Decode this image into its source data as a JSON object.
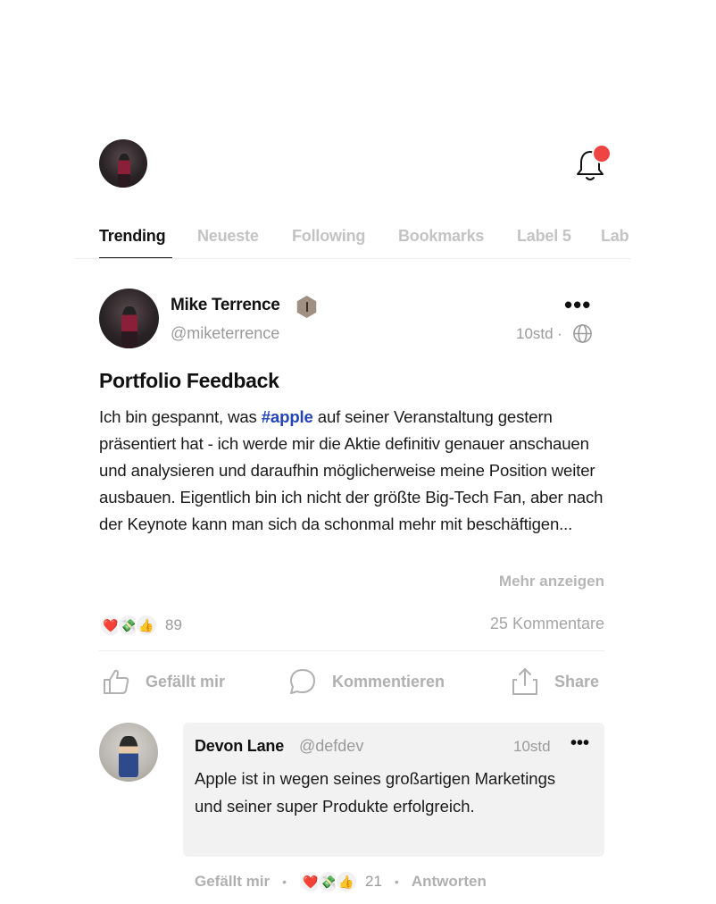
{
  "header": {
    "profile_avatar": "user-avatar",
    "notification_icon": "bell-icon",
    "notification_dot_color": "#ef4444"
  },
  "tabs": [
    {
      "label": "Trending",
      "active": true
    },
    {
      "label": "Neueste",
      "active": false
    },
    {
      "label": "Following",
      "active": false
    },
    {
      "label": "Bookmarks",
      "active": false
    },
    {
      "label": "Label 5",
      "active": false
    },
    {
      "label": "Lab",
      "active": false
    }
  ],
  "post": {
    "author": "Mike Terrence",
    "handle": "@miketerrence",
    "more_icon": "•••",
    "time": "10std ·",
    "visibility_icon": "globe-icon",
    "title": "Portfolio Feedback",
    "body_before": "Ich bin gespannt, was ",
    "hashtag": "#apple",
    "body_after": " auf seiner Veranstaltung gestern präsentiert hat - ich werde mir die Aktie definitiv genauer anschauen und analysieren und daraufhin möglicherweise meine Position weiter ausbauen. Eigentlich bin ich nicht der größte Big-Tech Fan, aber nach der Keynote kann man sich da schonmal mehr mit beschäftigen...",
    "show_more": "Mehr anzeigen",
    "reactions": [
      "❤️",
      "💸",
      "👍"
    ],
    "reaction_count": "89",
    "comment_count": "25 Kommentare"
  },
  "actions": {
    "like": "Gefällt mir",
    "comment": "Kommentieren",
    "share": "Share"
  },
  "comment": {
    "author": "Devon Lane",
    "handle": "@defdev",
    "time": "10std",
    "more_icon": "•••",
    "text": "Apple ist in wegen seines großartigen Marketings und seiner super Produkte erfolgreich.",
    "like": "Gefällt mir",
    "separator": "•",
    "reactions": [
      "❤️",
      "💸",
      "👍"
    ],
    "reaction_count": "21",
    "reply": "Antworten"
  },
  "colors": {
    "accent": "#2345b8",
    "muted": "#9a9a9a",
    "text": "#111111"
  }
}
